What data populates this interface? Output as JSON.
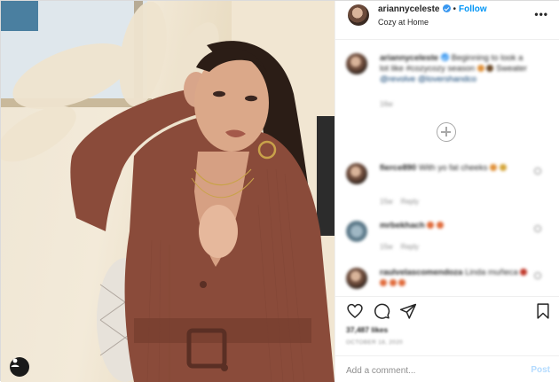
{
  "header": {
    "username": "ariannyceleste",
    "follow_label": "Follow",
    "separator": "•",
    "location": "Cozy at Home",
    "more_label": "•••"
  },
  "caption": {
    "username": "ariannyceleste",
    "text": "Beginning to look a lot like #cozycozy season",
    "text2": "Sweater",
    "tags": "@revolve @lovershandco",
    "time": "16w"
  },
  "comments": [
    {
      "username": "fierce890",
      "text": "With yo fat cheeks",
      "time": "15w",
      "reply": "Reply"
    },
    {
      "username": "mrbekhach",
      "text": "",
      "time": "15w",
      "reply": "Reply"
    },
    {
      "username": "raulvelascomendoza",
      "text": "Linda muñeca",
      "time": "",
      "reply": ""
    }
  ],
  "post": {
    "likes": "37,487 likes",
    "date": "OCTOBER 18, 2020"
  },
  "add_comment": {
    "placeholder": "Add a comment...",
    "post_label": "Post"
  },
  "icons": {
    "like": "heart-icon",
    "comment": "comment-icon",
    "share": "share-icon",
    "save": "bookmark-icon",
    "user_tag": "user-tag-icon",
    "load_more": "plus-circle-icon"
  },
  "colors": {
    "accent": "#0095f6",
    "verified": "#3897f0",
    "sweater": "#8a4b3a"
  }
}
